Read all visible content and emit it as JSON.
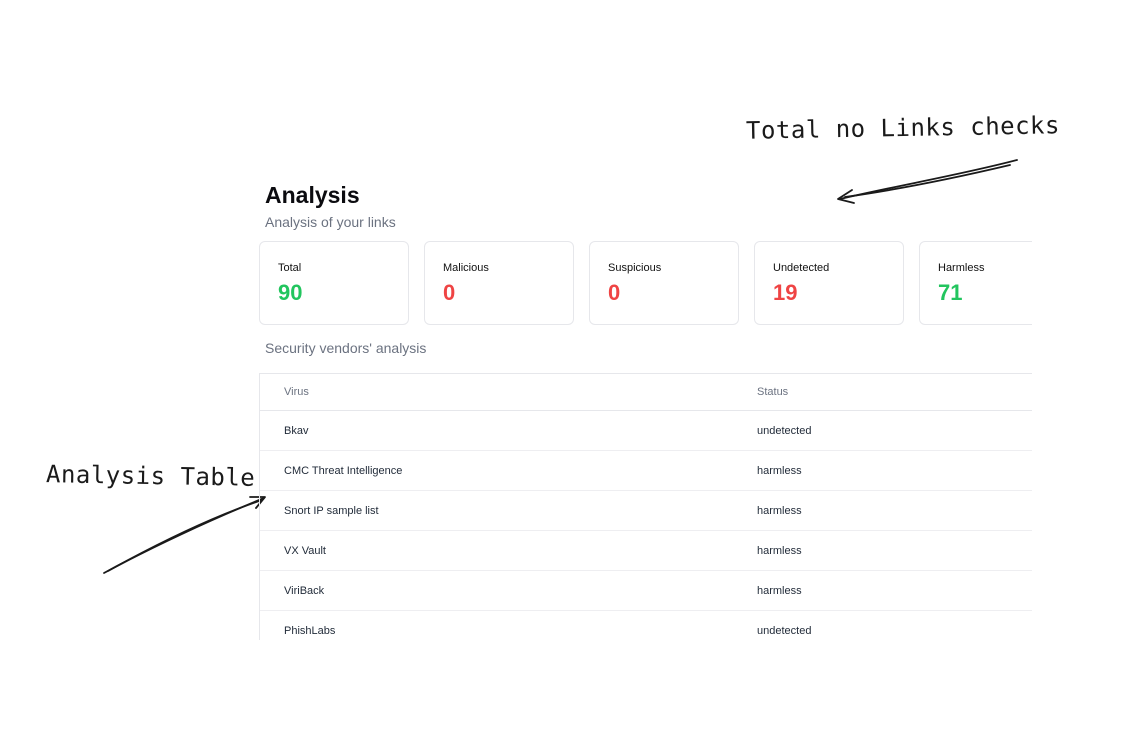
{
  "annotations": {
    "top_note": "Total no Links checks",
    "left_note": "Analysis Table"
  },
  "header": {
    "title": "Analysis",
    "subtitle": "Analysis of your links"
  },
  "stats": [
    {
      "label": "Total",
      "value": "90",
      "color": "#22c55e"
    },
    {
      "label": "Malicious",
      "value": "0",
      "color": "#ef4444"
    },
    {
      "label": "Suspicious",
      "value": "0",
      "color": "#ef4444"
    },
    {
      "label": "Undetected",
      "value": "19",
      "color": "#ef4444"
    },
    {
      "label": "Harmless",
      "value": "71",
      "color": "#22c55e"
    }
  ],
  "vendors": {
    "section_title": "Security vendors' analysis",
    "columns": [
      "Virus",
      "Status"
    ],
    "rows": [
      {
        "virus": "Bkav",
        "status": "undetected"
      },
      {
        "virus": "CMC Threat Intelligence",
        "status": "harmless"
      },
      {
        "virus": "Snort IP sample list",
        "status": "harmless"
      },
      {
        "virus": "VX Vault",
        "status": "harmless"
      },
      {
        "virus": "ViriBack",
        "status": "harmless"
      },
      {
        "virus": "PhishLabs",
        "status": "undetected"
      }
    ]
  }
}
